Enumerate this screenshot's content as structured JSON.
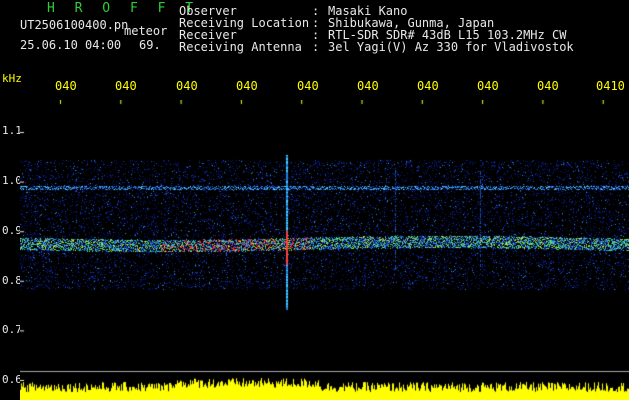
{
  "header": {
    "brand": "H R O F F T",
    "filename": "UT2506100400.pn",
    "meteor_label": "meteor",
    "datetime": "25.06.10 04:00",
    "meteor_count": "69."
  },
  "station_info": [
    {
      "label": "Observer",
      "value": "Masaki Kano"
    },
    {
      "label": "Receiving Location",
      "value": "Shibukawa, Gunma, Japan"
    },
    {
      "label": "Receiver",
      "value": "RTL-SDR SDR# 43dB L15 103.2MHz CW"
    },
    {
      "label": "Receiving Antenna",
      "value": "3el Yagi(V) Az 330 for Vladivostok"
    }
  ],
  "separator": ":",
  "y_axis": {
    "unit": "kHz",
    "ticks": [
      "1.1",
      "1.0",
      "0.9",
      "0.8",
      "0.7",
      "0.6"
    ]
  },
  "x_axis": {
    "ticks": [
      "040",
      "040",
      "040",
      "040",
      "040",
      "040",
      "040",
      "040",
      "040",
      "0410"
    ]
  },
  "colors": {
    "header_green": "#33cc33",
    "label_white": "#e8e8e8",
    "tick_yellow": "#ffff00",
    "background": "#000000"
  }
}
